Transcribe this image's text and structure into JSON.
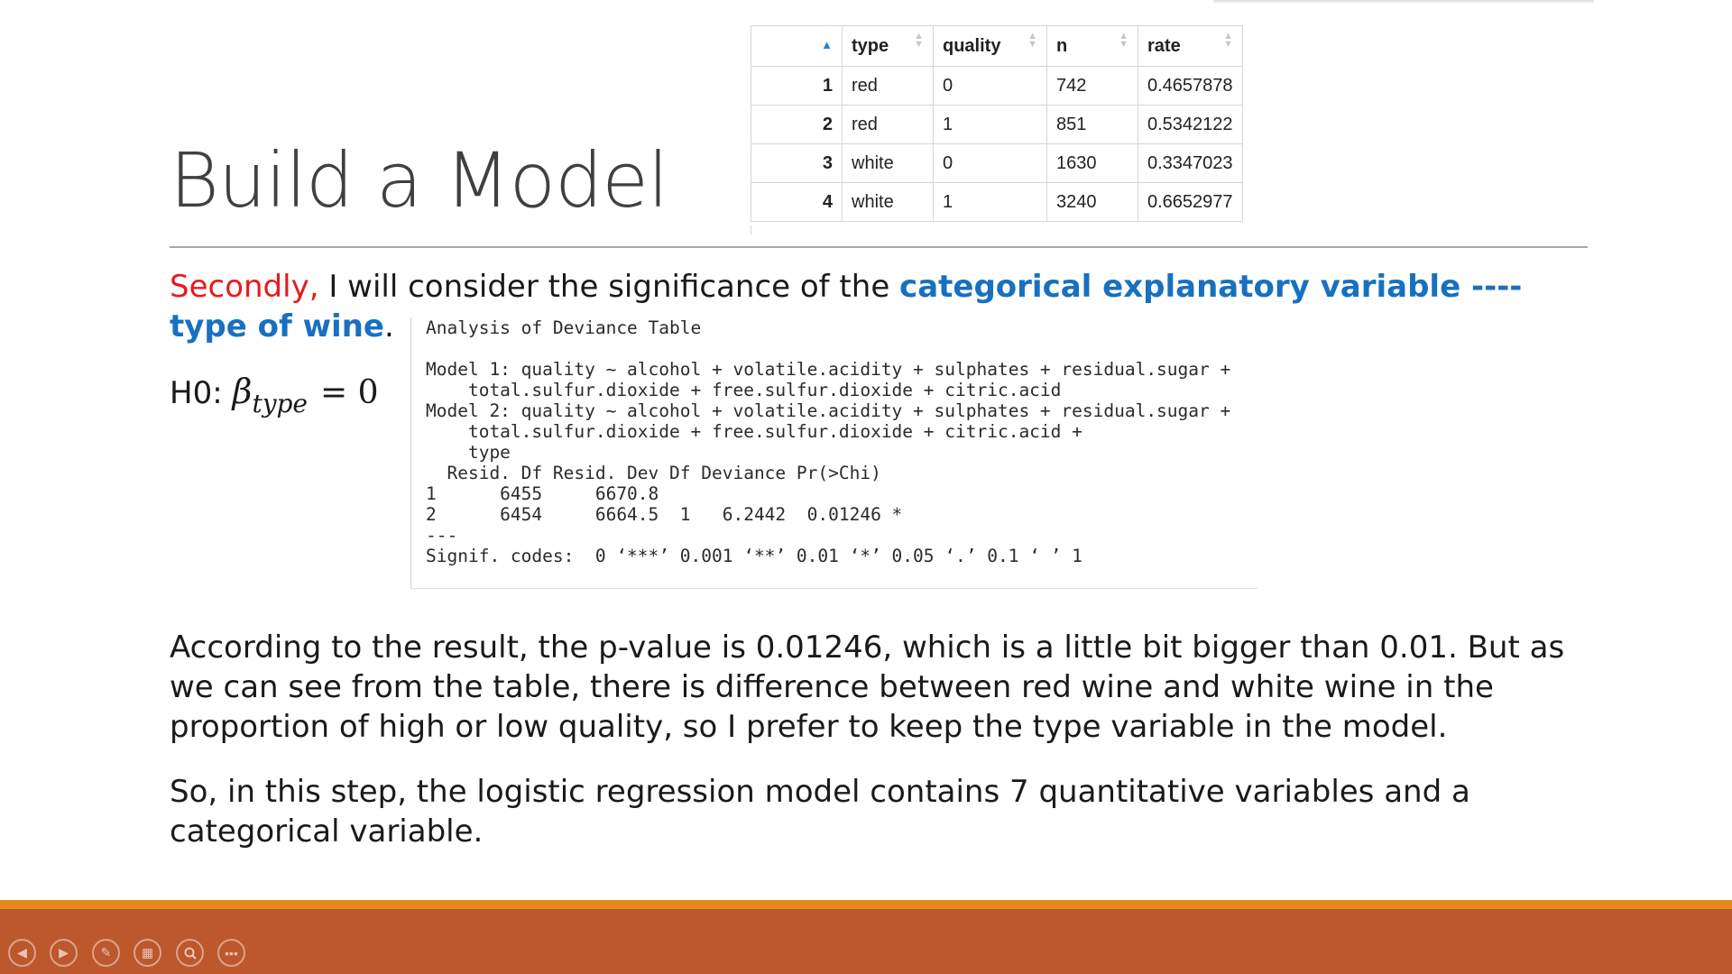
{
  "slide": {
    "title": "Build a Model",
    "paragraph1": {
      "lead_red": "Secondly,",
      "middle": " I will consider the significance of the ",
      "bold_blue": "categorical explanatory variable ---- type of wine",
      "end": "."
    },
    "hypothesis": {
      "prefix": "H0: ",
      "symbol": "β",
      "subscript": "type",
      "rhs": "= 0"
    },
    "data_table": {
      "columns": [
        "type",
        "quality",
        "n",
        "rate"
      ],
      "rows": [
        {
          "index": "1",
          "type": "red",
          "quality": "0",
          "n": "742",
          "rate": "0.4657878"
        },
        {
          "index": "2",
          "type": "red",
          "quality": "1",
          "n": "851",
          "rate": "0.5342122"
        },
        {
          "index": "3",
          "type": "white",
          "quality": "0",
          "n": "1630",
          "rate": "0.3347023"
        },
        {
          "index": "4",
          "type": "white",
          "quality": "1",
          "n": "3240",
          "rate": "0.6652977"
        }
      ]
    },
    "console_output": "Analysis of Deviance Table\n\nModel 1: quality ~ alcohol + volatile.acidity + sulphates + residual.sugar +\n    total.sulfur.dioxide + free.sulfur.dioxide + citric.acid\nModel 2: quality ~ alcohol + volatile.acidity + sulphates + residual.sugar +\n    total.sulfur.dioxide + free.sulfur.dioxide + citric.acid +\n    type\n  Resid. Df Resid. Dev Df Deviance Pr(>Chi)\n1      6455     6670.8\n2      6454     6664.5  1   6.2442  0.01246 *\n---\nSignif. codes:  0 ‘***’ 0.001 ‘**’ 0.01 ‘*’ 0.05 ‘.’ 0.1 ‘ ’ 1",
    "paragraph2": "According to the result, the p-value is 0.01246, which is a little bit bigger than 0.01. But as we can see from the table, there is difference between red wine and white wine in the proportion of high or low quality, so I prefer to keep the type variable in the model.",
    "paragraph3": "So, in this step, the logistic regression model contains 7 quantitative variables and a categorical variable."
  },
  "footer_controls": [
    {
      "icon": "previous-icon"
    },
    {
      "icon": "next-icon"
    },
    {
      "icon": "pen-icon"
    },
    {
      "icon": "slides-grid-icon"
    },
    {
      "icon": "zoom-icon"
    },
    {
      "icon": "more-options-icon"
    }
  ],
  "colors": {
    "accent_red": "#e8191c",
    "accent_blue": "#1870c0",
    "footer_orange": "#e38a1e",
    "footer_rust": "#bd582c"
  }
}
